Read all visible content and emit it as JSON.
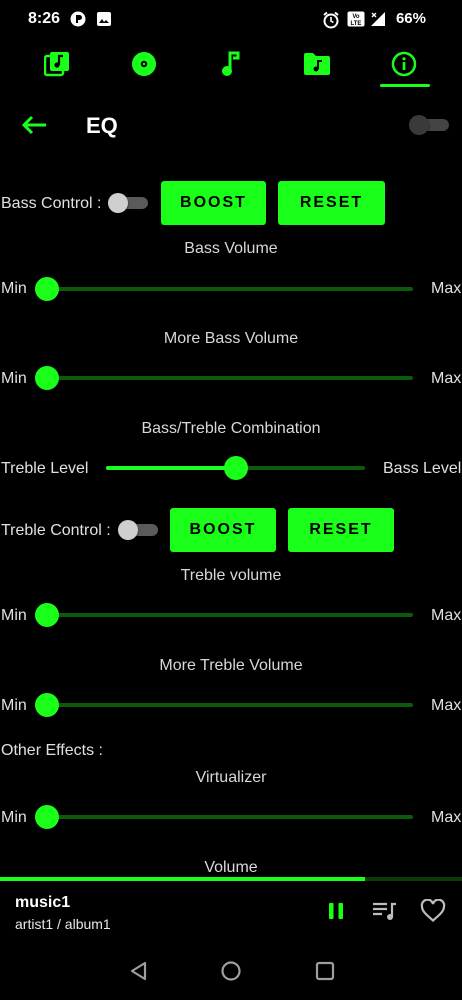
{
  "status_bar": {
    "time": "8:26",
    "battery": "66%",
    "left_icons": [
      "app-notification-icon",
      "image-icon"
    ],
    "right_icons": [
      "alarm-icon",
      "volte-icon",
      "signal-icon",
      "battery-icon"
    ]
  },
  "tabs": [
    {
      "name": "library",
      "icon": "music-library-icon"
    },
    {
      "name": "albums",
      "icon": "album-disc-icon"
    },
    {
      "name": "songs",
      "icon": "music-note-icon"
    },
    {
      "name": "folders",
      "icon": "music-folder-icon"
    },
    {
      "name": "info",
      "icon": "info-icon",
      "active": true
    }
  ],
  "header": {
    "title": "EQ",
    "eq_enabled": false
  },
  "bass": {
    "control_label": "Bass Control :",
    "control_on": false,
    "boost_label": "BOOST",
    "reset_label": "RESET",
    "volume_title": "Bass Volume",
    "volume_value": 0,
    "more_title": "More Bass Volume",
    "more_value": 0
  },
  "combo": {
    "title": "Bass/Treble Combination",
    "left_label": "Treble Level",
    "right_label": "Bass Level",
    "value": 0.5
  },
  "treble": {
    "control_label": "Treble Control :",
    "control_on": false,
    "boost_label": "BOOST",
    "reset_label": "RESET",
    "volume_title": "Treble volume",
    "volume_value": 0,
    "more_title": "More Treble Volume",
    "more_value": 0
  },
  "other": {
    "title": "Other Effects :",
    "virtualizer_title": "Virtualizer",
    "virtualizer_value": 0,
    "volume_title": "Volume"
  },
  "slider_labels": {
    "min": "Min",
    "max": "Max"
  },
  "player": {
    "title": "music1",
    "subtitle": "artist1 / album1",
    "progress": 0.79,
    "state": "playing"
  },
  "colors": {
    "accent": "#1aff1a",
    "track": "#0c5a0c",
    "background": "#000000"
  }
}
